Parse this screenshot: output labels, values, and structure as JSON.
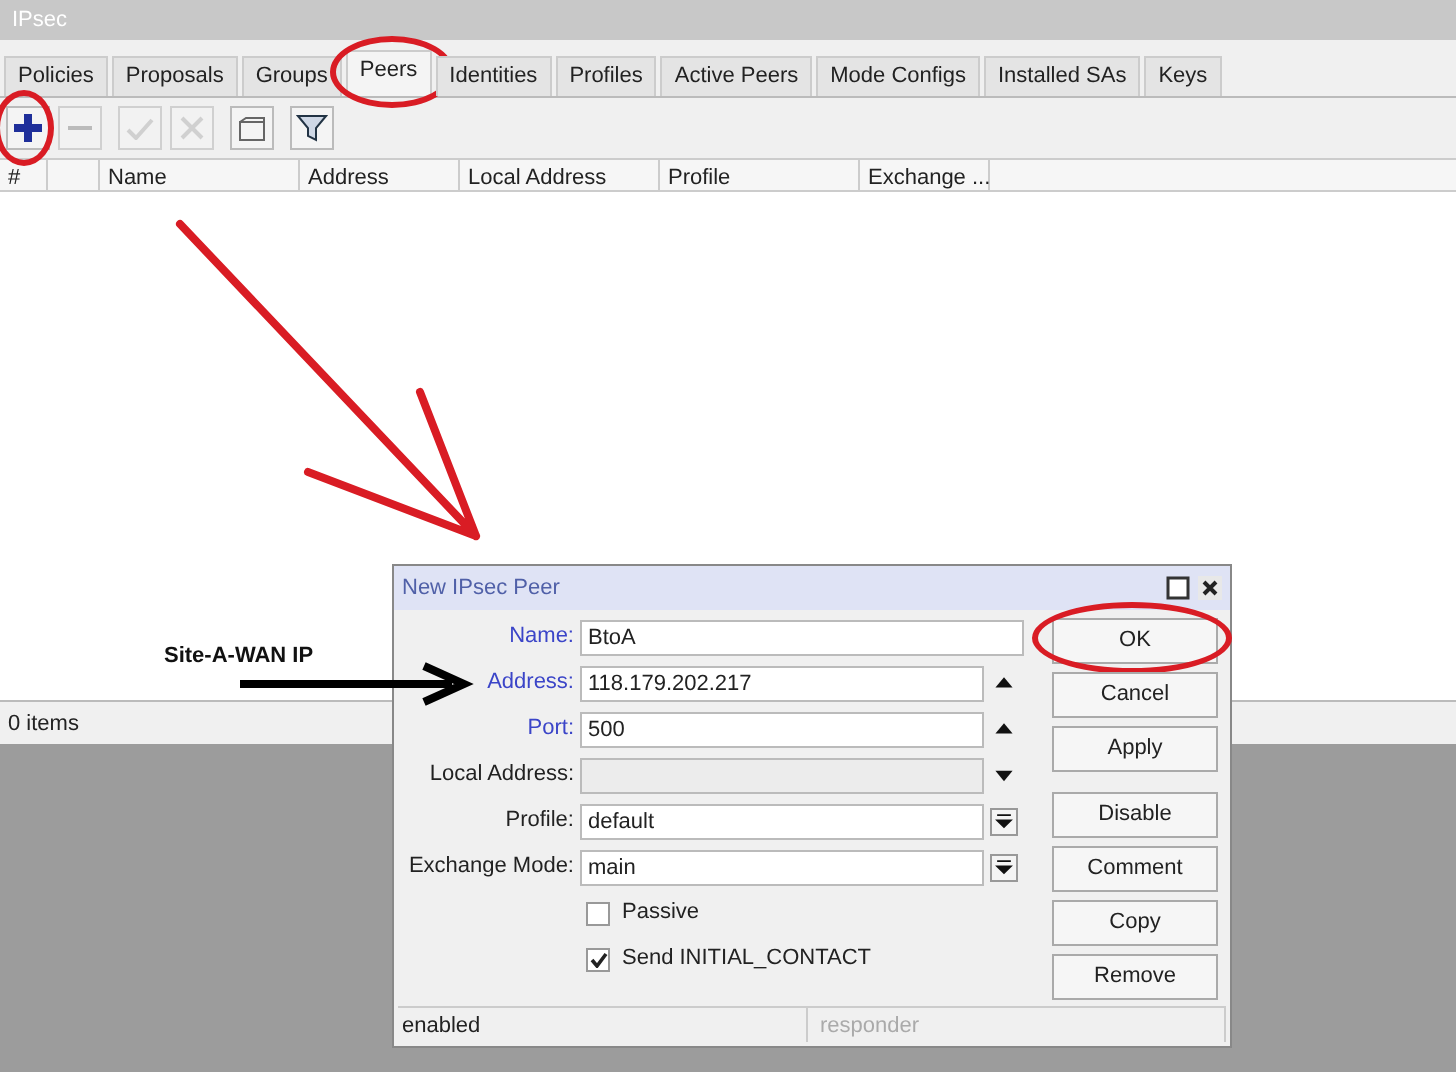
{
  "window": {
    "title": "IPsec"
  },
  "tabs": [
    {
      "label": "Policies",
      "selected": false,
      "circled": false
    },
    {
      "label": "Proposals",
      "selected": false,
      "circled": false
    },
    {
      "label": "Groups",
      "selected": false,
      "circled": false
    },
    {
      "label": "Peers",
      "selected": true,
      "circled": true
    },
    {
      "label": "Identities",
      "selected": false,
      "circled": false
    },
    {
      "label": "Profiles",
      "selected": false,
      "circled": false
    },
    {
      "label": "Active Peers",
      "selected": false,
      "circled": false
    },
    {
      "label": "Mode Configs",
      "selected": false,
      "circled": false
    },
    {
      "label": "Installed SAs",
      "selected": false,
      "circled": false
    },
    {
      "label": "Keys",
      "selected": false,
      "circled": false
    }
  ],
  "toolbar": [
    {
      "kind": "add",
      "disabled": false,
      "circled": true
    },
    {
      "kind": "remove",
      "disabled": true,
      "circled": false
    },
    {
      "kind": "enable",
      "disabled": true,
      "circled": false
    },
    {
      "kind": "disable",
      "disabled": true,
      "circled": false
    },
    {
      "kind": "comment",
      "disabled": false,
      "circled": false
    },
    {
      "kind": "filter",
      "disabled": false,
      "circled": false
    }
  ],
  "table": {
    "columns": [
      "#",
      "",
      "Name",
      "Address",
      "Local Address",
      "Profile",
      "Exchange ..."
    ]
  },
  "status_bar": "0 items",
  "annotation": {
    "label": "Site-A-WAN IP"
  },
  "dialog": {
    "title": "New IPsec Peer",
    "fields": [
      {
        "label": "Name:",
        "value": "BtoA",
        "highlight": true,
        "disabled": false,
        "kind": "plain"
      },
      {
        "label": "Address:",
        "value": "118.179.202.217",
        "highlight": true,
        "disabled": false,
        "kind": "up"
      },
      {
        "label": "Port:",
        "value": "500",
        "highlight": true,
        "disabled": false,
        "kind": "up"
      },
      {
        "label": "Local Address:",
        "highlight": false,
        "disabled": true,
        "kind": "down"
      },
      {
        "label": "Profile:",
        "value": "default",
        "highlight": false,
        "disabled": false,
        "kind": "select"
      },
      {
        "label": "Exchange Mode:",
        "value": "main",
        "highlight": false,
        "disabled": false,
        "kind": "select"
      }
    ],
    "checkboxes": [
      {
        "label": "Passive",
        "checked": false
      },
      {
        "label": "Send INITIAL_CONTACT",
        "checked": true
      }
    ],
    "buttons": [
      {
        "label": "OK",
        "circled": true
      },
      {
        "label": "Cancel",
        "circled": false
      },
      {
        "label": "Apply",
        "circled": false
      },
      {
        "label": "Disable",
        "circled": false
      },
      {
        "label": "Comment",
        "circled": false
      },
      {
        "label": "Copy",
        "circled": false
      },
      {
        "label": "Remove",
        "circled": false
      }
    ],
    "status": [
      {
        "text": "enabled",
        "disabled": false
      },
      {
        "text": "responder",
        "disabled": true
      }
    ]
  }
}
